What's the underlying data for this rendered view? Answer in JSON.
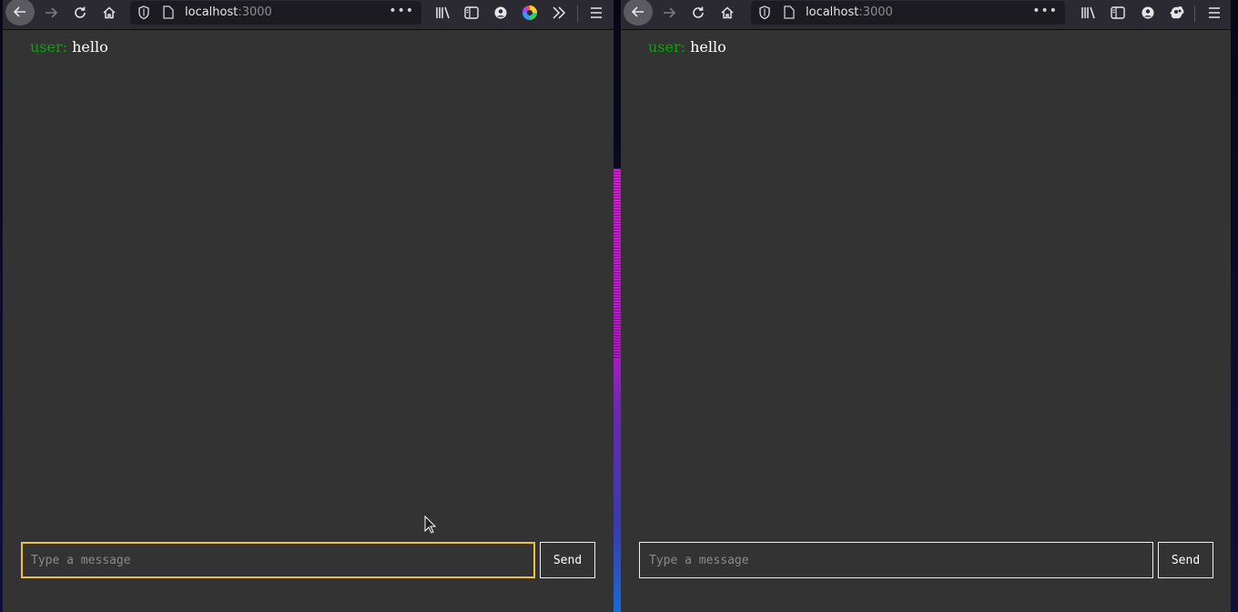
{
  "browsers": [
    {
      "url_host": "localhost",
      "url_port": ":3000",
      "messages": [
        {
          "user": "user:",
          "text": "hello"
        }
      ],
      "input": {
        "placeholder": "Type a message",
        "value": ""
      },
      "send_label": "Send"
    },
    {
      "url_host": "localhost",
      "url_port": ":3000",
      "messages": [
        {
          "user": "user:",
          "text": "hello"
        }
      ],
      "input": {
        "placeholder": "Type a message",
        "value": ""
      },
      "send_label": "Send"
    }
  ],
  "icons": [
    "back-icon",
    "forward-icon",
    "reload-icon",
    "home-icon",
    "shield-icon",
    "page-icon",
    "more-icon",
    "library-icon",
    "sidebar-icon",
    "account-icon",
    "extension-icon",
    "overflow-icon",
    "menu-icon"
  ],
  "colors": {
    "accent_focus": "#f0c040",
    "username": "#10a010",
    "background": "#333333"
  }
}
